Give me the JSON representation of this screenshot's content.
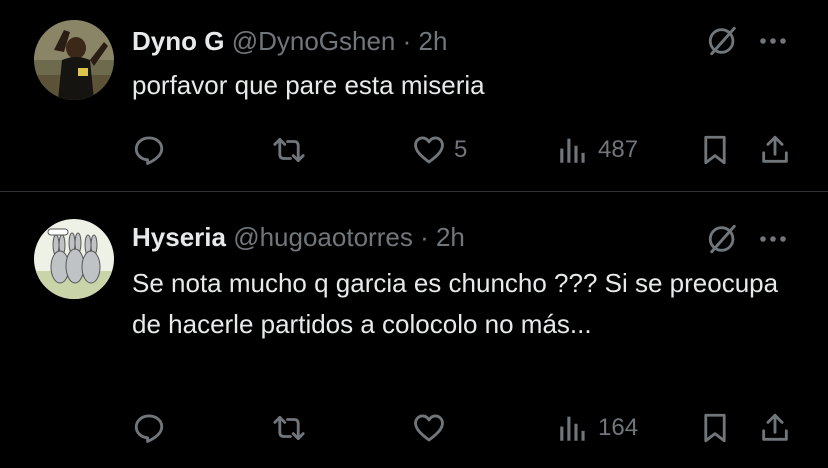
{
  "tweets": [
    {
      "display_name": "Dyno G",
      "handle": "@DynoGshen",
      "separator": "·",
      "time": "2h",
      "text": "porfavor que pare esta miseria",
      "likes": "5",
      "views": "487",
      "avatar_icon": "person-dancing-avatar"
    },
    {
      "display_name": "Hyseria",
      "handle": "@hugoaotorres",
      "separator": "·",
      "time": "2h",
      "text": "Se nota mucho q garcia es chuncho ??? Si se preocupa de hacerle partidos a colocolo no más...",
      "likes": "",
      "views": "164",
      "avatar_icon": "rabbits-cartoon-avatar"
    }
  ],
  "colors": {
    "background": "#000000",
    "text_primary": "#e7e9ea",
    "text_secondary": "#71767b",
    "divider": "#2f3336"
  },
  "icons": [
    "grok-icon",
    "more-icon",
    "reply-icon",
    "retweet-icon",
    "like-icon",
    "views-icon",
    "bookmark-icon",
    "share-icon"
  ]
}
